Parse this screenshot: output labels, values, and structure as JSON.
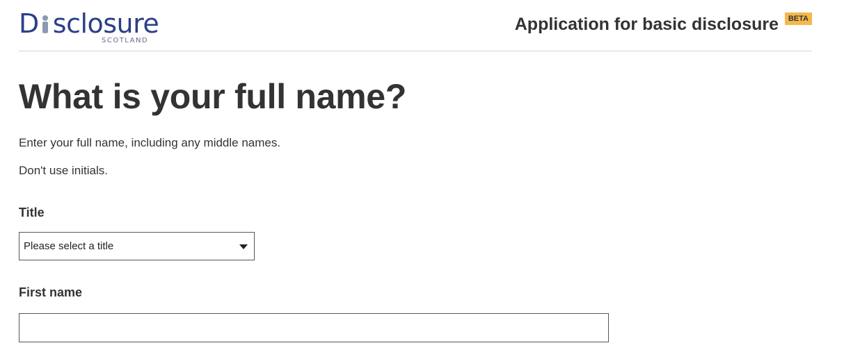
{
  "header": {
    "logo_text_prefix": "D",
    "logo_text_suffix": "sclosure",
    "logo_subtext": "SCOTLAND",
    "service_title": "Application for basic disclosure",
    "beta_tag": "BETA"
  },
  "main": {
    "heading": "What is your full name?",
    "hint_1": "Enter your full name, including any middle names.",
    "hint_2": "Don't use initials.",
    "title_field": {
      "label": "Title",
      "selected_value": "Please select a title"
    },
    "first_name_field": {
      "label": "First name",
      "value": ""
    }
  },
  "icons": {
    "logo_figure": "person-figure-icon",
    "dropdown": "triangle-down-icon"
  },
  "colors": {
    "brand_blue": "#2c3f88",
    "beta_orange": "#f5b84c",
    "text": "#333333"
  }
}
